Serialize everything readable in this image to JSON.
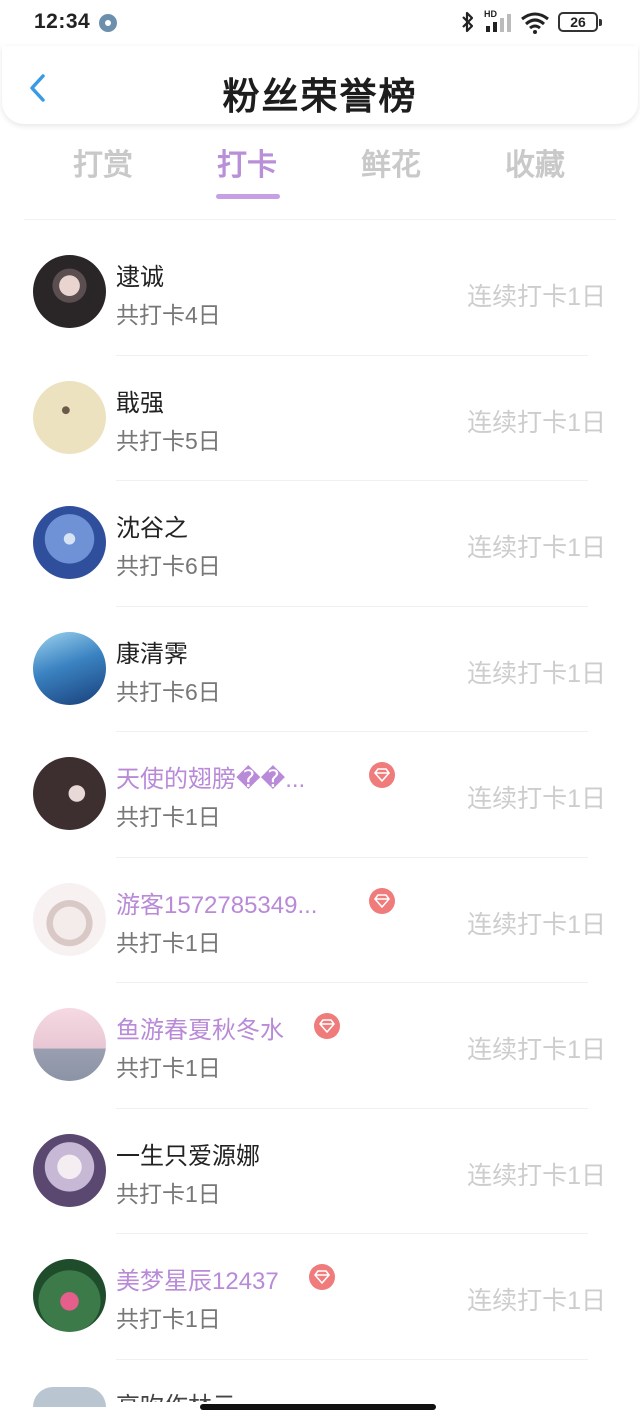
{
  "status": {
    "time": "12:34",
    "battery": "26",
    "network": "HD"
  },
  "header": {
    "title": "粉丝荣誉榜"
  },
  "tabs": [
    {
      "label": "打赏",
      "active": false
    },
    {
      "label": "打卡",
      "active": true
    },
    {
      "label": "鲜花",
      "active": false
    },
    {
      "label": "收藏",
      "active": false
    }
  ],
  "colors": {
    "accent": "#b98fd8",
    "vip_name": "#b88ad8",
    "vip_badge": "#ef7b7b",
    "back_arrow": "#3a9be3"
  },
  "fans": [
    {
      "name": "逮诚",
      "count": "共打卡4日",
      "streak": "连续打卡1日",
      "vip": false,
      "avatar": "girl-dark"
    },
    {
      "name": "戢强",
      "count": "共打卡5日",
      "streak": "连续打卡1日",
      "vip": false,
      "avatar": "ink-sketch"
    },
    {
      "name": "沈谷之",
      "count": "共打卡6日",
      "streak": "连续打卡1日",
      "vip": false,
      "avatar": "blue-flower"
    },
    {
      "name": "康清霁",
      "count": "共打卡6日",
      "streak": "连续打卡1日",
      "vip": false,
      "avatar": "blue-figure"
    },
    {
      "name": "天使的翅膀��...",
      "count": "共打卡1日",
      "streak": "连续打卡1日",
      "vip": true,
      "avatar": "dark-hair"
    },
    {
      "name": "游客1572785349...",
      "count": "共打卡1日",
      "streak": "连续打卡1日",
      "vip": true,
      "avatar": "anime-white"
    },
    {
      "name": "鱼游春夏秋冬水",
      "count": "共打卡1日",
      "streak": "连续打卡1日",
      "vip": true,
      "avatar": "pastel-cat"
    },
    {
      "name": "一生只爱源娜",
      "count": "共打卡1日",
      "streak": "连续打卡1日",
      "vip": false,
      "avatar": "anime-purple"
    },
    {
      "name": "美梦星辰12437",
      "count": "共打卡1日",
      "streak": "连续打卡1日",
      "vip": true,
      "avatar": "lotus"
    }
  ],
  "partial_row": {
    "name": "高吹作林云"
  }
}
